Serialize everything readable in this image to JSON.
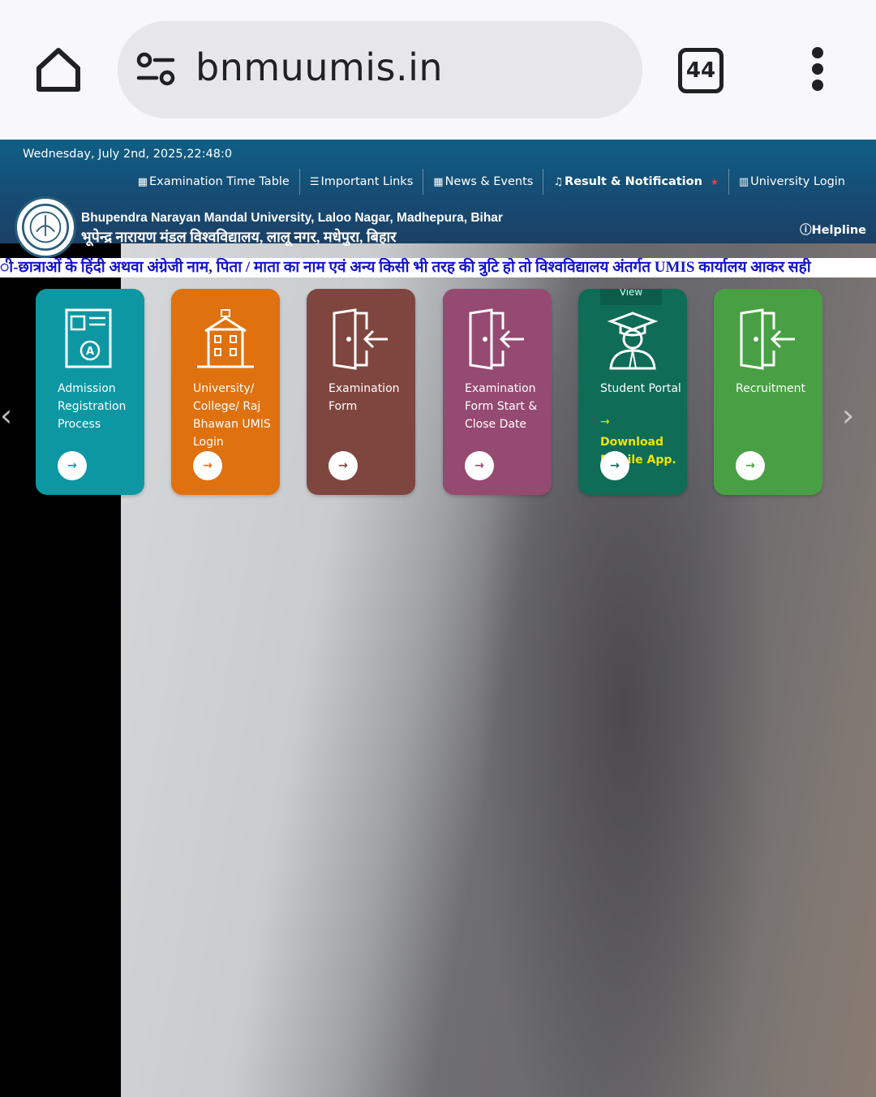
{
  "browser": {
    "url": "bnmuumis.in",
    "tab_count": "44"
  },
  "site": {
    "datetime": "Wednesday, July 2nd, 2025,22:48:0",
    "nav": [
      {
        "label": "Examination Time Table"
      },
      {
        "label": "Important Links"
      },
      {
        "label": "News & Events"
      },
      {
        "label": "Result & Notification"
      },
      {
        "label": "University Login"
      }
    ],
    "university_name_en": "Bhupendra Narayan Mandal University, Laloo Nagar, Madhepura, Bihar",
    "university_name_hi": "भूपेन्द्र नारायण मंडल विश्वविद्यालय, लालू नगर, मधेपुरा, बिहार",
    "helpline": "Helpline",
    "marquee": "ी-छात्राओं के हिंदी अथवा अंग्रेजी नाम, पिता / माता का नाम एवं अन्य किसी भी तरह की त्रुटि हो तो विश्वविद्यालय अंतर्गत UMIS कार्यालय आकर सही"
  },
  "cards": [
    {
      "title": "Admission Registration Process",
      "color": "#0d97a3"
    },
    {
      "title": "University/ College/ Raj Bhawan UMIS Login",
      "color": "#df710f"
    },
    {
      "title": "Examination Form",
      "color": "#7f4640"
    },
    {
      "title": "Examination Form Start & Close Date",
      "color": "#954a72"
    },
    {
      "title": "Student Portal",
      "view_tab": "View",
      "extra": "Download Mobile App.",
      "color": "#0e6c57"
    },
    {
      "title": "Recruitment",
      "color": "#49a044"
    }
  ],
  "icons": {
    "arrow": "→",
    "prev": "‹",
    "next": "›"
  }
}
